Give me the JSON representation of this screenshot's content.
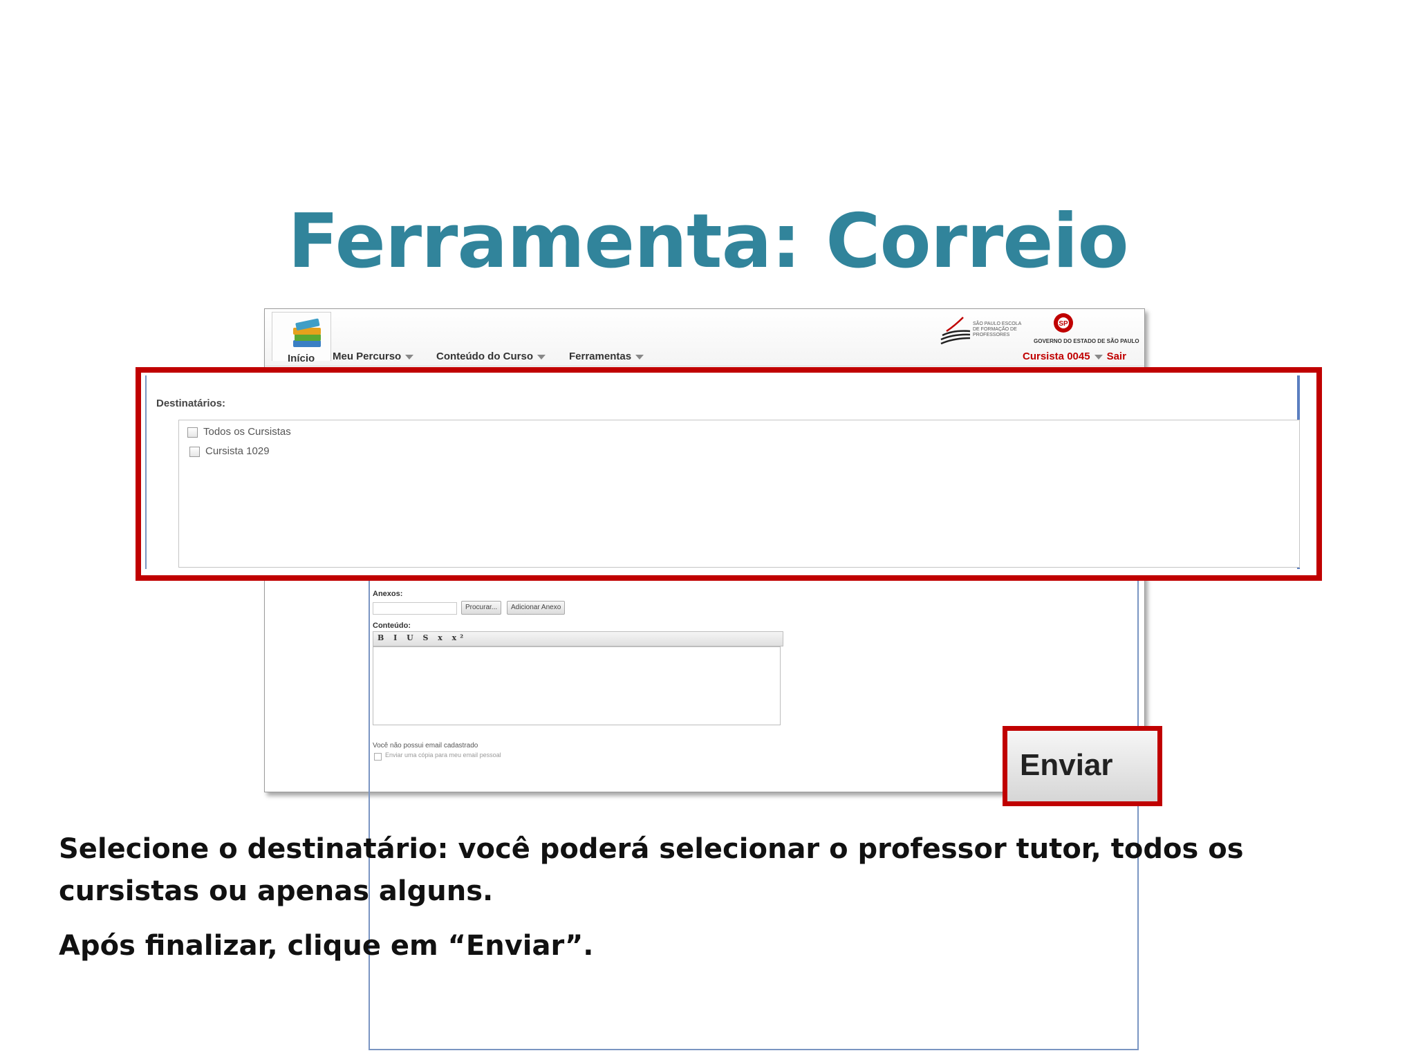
{
  "slide": {
    "title": "Ferramenta: Correio",
    "instruction_1": "Selecione o destinatário: você poderá selecionar o professor tutor, todos os cursistas ou apenas alguns.",
    "instruction_2": "Após finalizar, clique em “Enviar”."
  },
  "header": {
    "home_label": "Início",
    "menu": [
      "Meu Percurso",
      "Conteúdo do Curso",
      "Ferramentas"
    ],
    "school_logo_text": "SÃO PAULO ESCOLA DE FORMAÇÃO DE PROFESSORES",
    "gov_text": "GOVERNO DO ESTADO DE SÃO PAULO",
    "user": "Cursista 0045",
    "logout": "Sair"
  },
  "recipients": {
    "label": "Destinatários:",
    "options": [
      {
        "label": "Todos os Cursistas",
        "checked": false
      },
      {
        "label": "Cursista 1029",
        "checked": false
      }
    ]
  },
  "form": {
    "annex_label": "Anexos:",
    "browse_button": "Procurar...",
    "add_annex_button": "Adicionar Anexo",
    "content_label": "Conteúdo:",
    "no_email_note": "Você não possui email cadastrado",
    "send_copy_option": "Enviar uma cópia para meu email pessoal",
    "toolbar": "B I U S x x²"
  },
  "send_button": "Enviar",
  "colors": {
    "title": "#31849b",
    "highlight": "#c00000"
  }
}
